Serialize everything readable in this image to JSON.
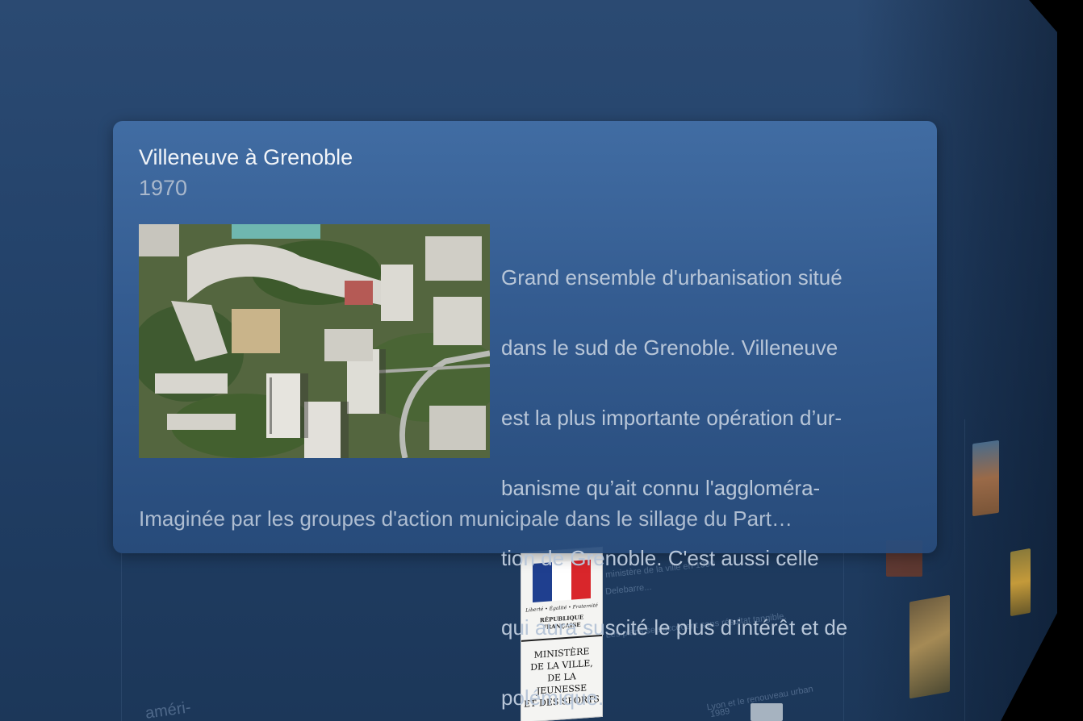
{
  "card": {
    "title": "Villeneuve à Grenoble",
    "year": "1970",
    "photo_icon": "aerial-photo",
    "description_lines": [
      "Grand ensemble d'urbanisation situé",
      "dans le sud de Grenoble. Villeneuve",
      "est la plus importante opération d’ur-",
      "banisme qu’ait connu l'aggloméra-",
      "tion de Grenoble. C'est aussi celle",
      "qui aura suscité le plus d’intérêt et de",
      "polémique."
    ],
    "continuation": "Imaginée par les groupes d'action municipale dans le sillage du Part…"
  },
  "background": {
    "text_1": "ministère de la ville en 1990",
    "text_2": "Delebarre...",
    "text_3": "Les plans se succèdent sans résultat tangible.",
    "text_4": "Lyon et le renouveau urban",
    "text_5": "1989",
    "text_6": "améri-"
  },
  "ministry_logo": {
    "motto": "Liberté • Égalité • Fraternité",
    "country": "RÉPUBLIQUE FRANÇAISE",
    "name": "MINISTÈRE\nDE LA VILLE,\nDE LA JEUNESSE\nET DES SPORTS"
  },
  "colors": {
    "panel": "#24436b",
    "card": "#426ea5",
    "title": "#f1f4f8",
    "subtext": "#a9b8cc"
  }
}
